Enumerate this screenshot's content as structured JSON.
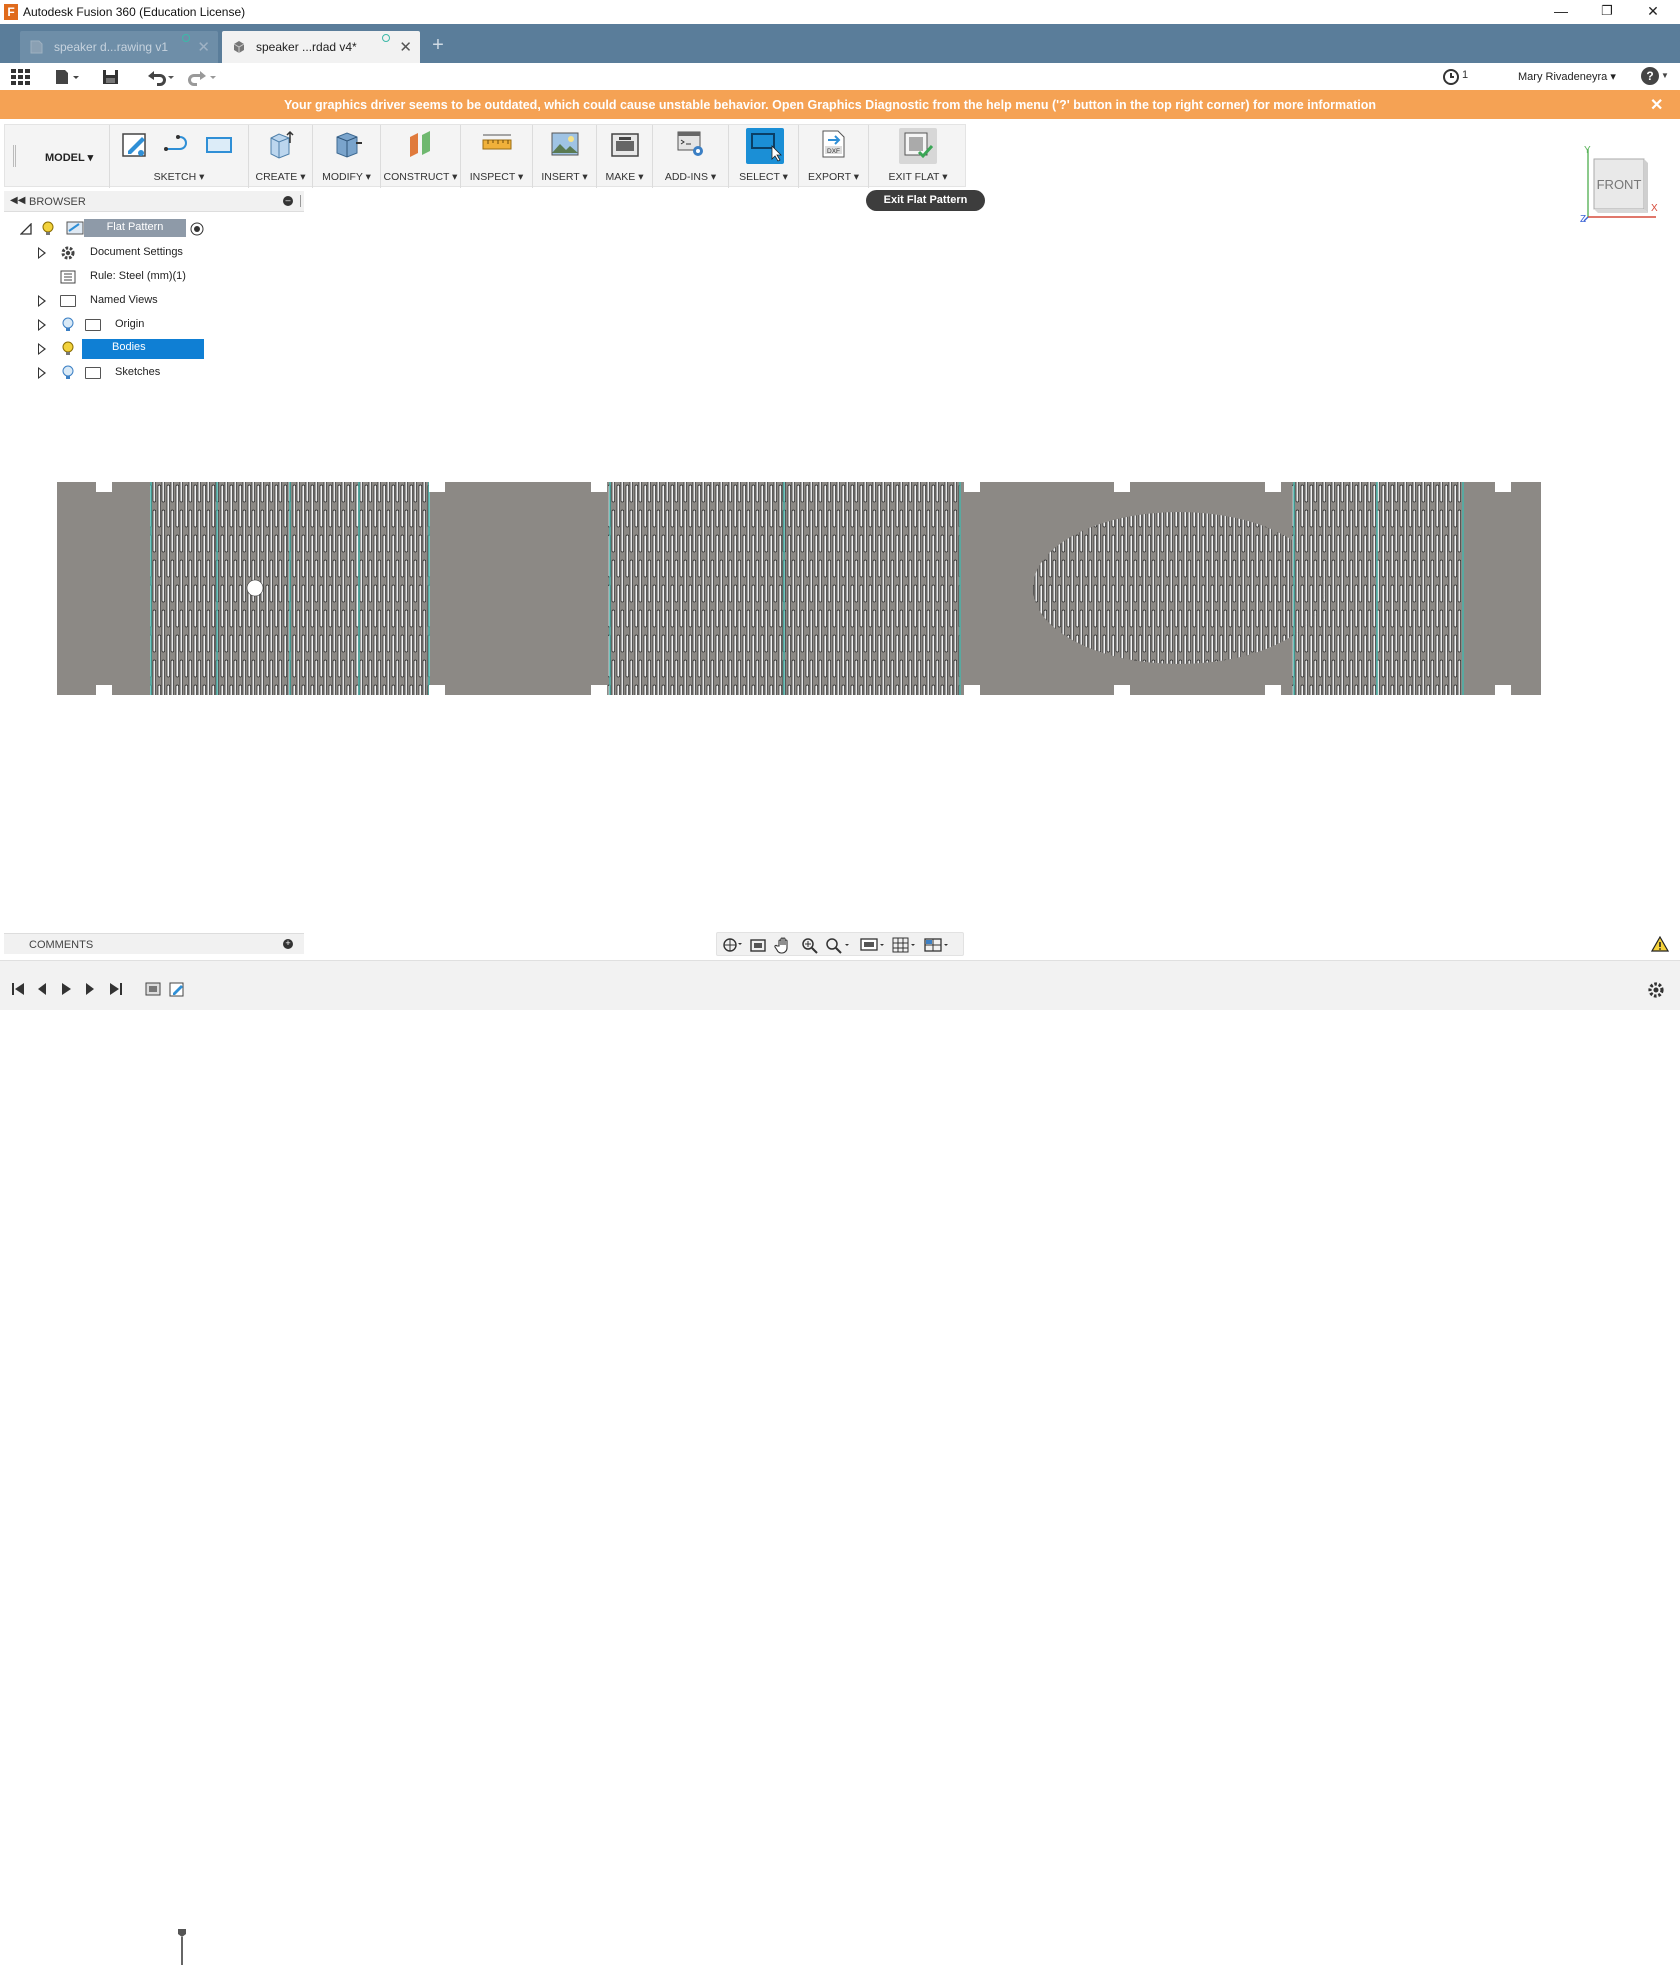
{
  "window": {
    "title": "Autodesk Fusion 360 (Education License)",
    "app_icon_letter": "F",
    "minimize": "—",
    "restore": "❐",
    "close": "✕"
  },
  "tabs": [
    {
      "label": "speaker d...rawing v1",
      "active": false
    },
    {
      "label": "speaker ...rdad v4*",
      "active": true
    }
  ],
  "tab_close": "✕",
  "tab_add": "+",
  "qat": {
    "history_count": "1",
    "user": "Mary Rivadeneyra ▾",
    "help": "?"
  },
  "banner": {
    "message": "Your graphics driver seems to be outdated, which could cause unstable behavior. Open Graphics Diagnostic from the help menu ('?' button in the top right corner) for more information",
    "close": "✕"
  },
  "ribbon": {
    "workspace": "MODEL ▾",
    "groups": [
      "SKETCH ▾",
      "CREATE ▾",
      "MODIFY ▾",
      "CONSTRUCT ▾",
      "INSPECT ▾",
      "INSERT ▾",
      "MAKE ▾",
      "ADD-INS ▾",
      "SELECT ▾",
      "EXPORT ▾",
      "EXIT FLAT ▾"
    ]
  },
  "tooltip": "Exit Flat Pattern",
  "viewcube": {
    "face": "FRONT",
    "x": "X",
    "y": "Y",
    "z": "Z"
  },
  "browser": {
    "title": "BROWSER",
    "items": [
      {
        "label": "Flat Pattern"
      },
      {
        "label": "Document Settings"
      },
      {
        "label": "Rule: Steel (mm)(1)"
      },
      {
        "label": "Named Views"
      },
      {
        "label": "Origin"
      },
      {
        "label": "Bodies"
      },
      {
        "label": "Sketches"
      }
    ]
  },
  "comments": {
    "title": "COMMENTS"
  },
  "colors": {
    "tabbar": "#5a7d9a",
    "banner": "#f5a254",
    "selection": "#0f7fd4",
    "part": "#8c8985",
    "seam": "#46b6ac"
  }
}
